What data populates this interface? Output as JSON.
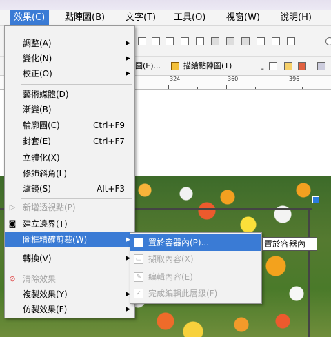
{
  "menubar": {
    "items": [
      {
        "label": "效果(C)"
      },
      {
        "label": "點陣圖(B)"
      },
      {
        "label": "文字(T)"
      },
      {
        "label": "工具(O)"
      },
      {
        "label": "視窗(W)"
      },
      {
        "label": "說明(H)"
      }
    ]
  },
  "toolbar": {
    "bitmap_mode_label": "圖(E)...",
    "trace_bitmap_label": "描繪點陣圖(T)",
    "ruler_numbers": [
      "324",
      "360",
      "396"
    ]
  },
  "menu": {
    "items": [
      {
        "label": "調整(A)",
        "shortcut": "",
        "submenu": true
      },
      {
        "label": "變化(N)",
        "shortcut": "",
        "submenu": true
      },
      {
        "label": "校正(O)",
        "shortcut": "",
        "submenu": true
      },
      {
        "label": "藝術媒體(D)",
        "shortcut": ""
      },
      {
        "label": "漸變(B)",
        "shortcut": ""
      },
      {
        "label": "輪廓圖(C)",
        "shortcut": "Ctrl+F9"
      },
      {
        "label": "封套(E)",
        "shortcut": "Ctrl+F7"
      },
      {
        "label": "立體化(X)",
        "shortcut": ""
      },
      {
        "label": "修飾斜角(L)",
        "shortcut": ""
      },
      {
        "label": "濾鏡(S)",
        "shortcut": "Alt+F3"
      },
      {
        "label": "新增透視點(P)",
        "shortcut": "",
        "disabled": true
      },
      {
        "label": "建立邊界(T)",
        "shortcut": ""
      },
      {
        "label": "圖框精確剪裁(W)",
        "shortcut": "",
        "submenu": true,
        "highlighted": true
      },
      {
        "label": "轉換(V)",
        "shortcut": "",
        "submenu": true
      },
      {
        "label": "清除效果",
        "shortcut": "",
        "disabled": true
      },
      {
        "label": "複製效果(Y)",
        "shortcut": "",
        "submenu": true
      },
      {
        "label": "仿製效果(F)",
        "shortcut": "",
        "submenu": true
      }
    ]
  },
  "submenu": {
    "items": [
      {
        "label": "置於容器內(P)...",
        "highlighted": true
      },
      {
        "label": "擷取內容(X)",
        "disabled": true
      },
      {
        "label": "編輯內容(E)",
        "disabled": true
      },
      {
        "label": "完成編輯此層級(F)",
        "disabled": true
      }
    ]
  },
  "tooltip": {
    "text": "置於容器內"
  }
}
